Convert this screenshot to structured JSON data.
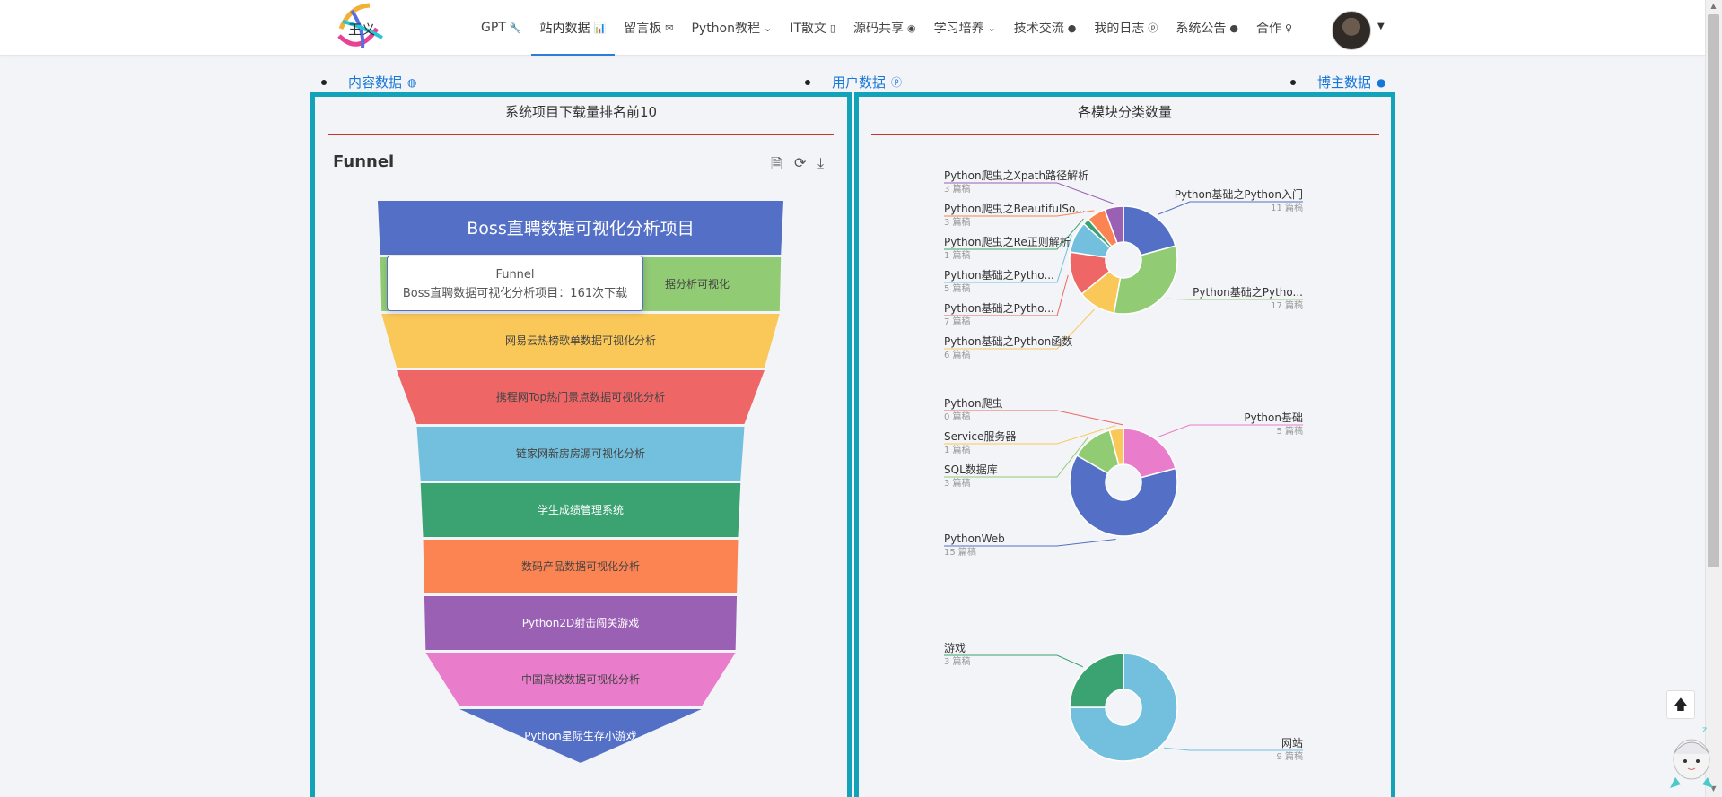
{
  "nav": {
    "items": [
      {
        "label": "GPT",
        "icon": "🔧"
      },
      {
        "label": "站内数据",
        "icon": "📊",
        "active": true
      },
      {
        "label": "留言板",
        "icon": "✉"
      },
      {
        "label": "Python教程",
        "icon": "⌄"
      },
      {
        "label": "IT散文",
        "icon": "▯"
      },
      {
        "label": "源码共享",
        "icon": "◉"
      },
      {
        "label": "学习培养",
        "icon": "⌄"
      },
      {
        "label": "技术交流",
        "icon": "●"
      },
      {
        "label": "我的日志",
        "icon": "ⓟ"
      },
      {
        "label": "系统公告",
        "icon": "●"
      },
      {
        "label": "合作",
        "icon": "♀"
      }
    ],
    "logo_icon": "logo-mark"
  },
  "tabs": [
    {
      "label": "内容数据",
      "icon": "◍"
    },
    {
      "label": "用户数据",
      "icon": "ⓟ"
    },
    {
      "label": "博主数据",
      "icon": "●"
    }
  ],
  "left_panel": {
    "title": "系统项目下载量排名前10",
    "chart_heading": "Funnel",
    "tooltip": {
      "title": "Funnel",
      "body": "Boss直聘数据可视化分析项目：161次下载"
    }
  },
  "right_panel": {
    "title": "各模块分类数量"
  },
  "chart_data": [
    {
      "type": "funnel",
      "title": "Funnel",
      "series_name": "Funnel",
      "categories": [
        "Boss直聘数据可视化分析项目",
        "",
        "网易云热榜歌单数据可视化分析",
        "携程网Top热门景点数据可视化分析",
        "链家网新房房源可视化分析",
        "学生成绩管理系统",
        "数码产品数据可视化分析",
        "Python2D射击闯关游戏",
        "中国高校数据可视化分析",
        "Python星际生存小游戏"
      ],
      "values": [
        161,
        159,
        158,
        146,
        130,
        127,
        125,
        124,
        123,
        96
      ],
      "colors": [
        "#5470c6",
        "#91cc75",
        "#fac858",
        "#ee6666",
        "#73c0de",
        "#3ba272",
        "#fc8452",
        "#9a60b4",
        "#ea7ccc",
        "#5470c6"
      ],
      "visible_label_2": "据分析可视化"
    },
    {
      "type": "pie",
      "donut": true,
      "slices": [
        {
          "name": "Python基础之Python入门",
          "value": 11,
          "label": "11 篇稿",
          "color": "#5470c6"
        },
        {
          "name": "Python基础之Pytho...",
          "value": 17,
          "label": "17 篇稿",
          "color": "#91cc75"
        },
        {
          "name": "Python基础之Python函数",
          "value": 6,
          "label": "6 篇稿",
          "color": "#fac858"
        },
        {
          "name": "Python基础之Pytho...",
          "value": 7,
          "label": "7 篇稿",
          "color": "#ee6666"
        },
        {
          "name": "Python基础之Pytho...",
          "value": 5,
          "label": "5 篇稿",
          "color": "#73c0de"
        },
        {
          "name": "Python爬虫之Re正则解析",
          "value": 1,
          "label": "1 篇稿",
          "color": "#3ba272"
        },
        {
          "name": "Python爬虫之BeautifulSo...",
          "value": 3,
          "label": "3 篇稿",
          "color": "#fc8452"
        },
        {
          "name": "Python爬虫之Xpath路径解析",
          "value": 3,
          "label": "3 篇稿",
          "color": "#9a60b4"
        }
      ]
    },
    {
      "type": "pie",
      "donut": true,
      "slices": [
        {
          "name": "Python基础",
          "value": 5,
          "label": "5 篇稿",
          "color": "#ea7ccc"
        },
        {
          "name": "PythonWeb",
          "value": 15,
          "label": "15 篇稿",
          "color": "#5470c6"
        },
        {
          "name": "SQL数据库",
          "value": 3,
          "label": "3 篇稿",
          "color": "#91cc75"
        },
        {
          "name": "Service服务器",
          "value": 1,
          "label": "1 篇稿",
          "color": "#fac858"
        },
        {
          "name": "Python爬虫",
          "value": 0,
          "label": "0 篇稿",
          "color": "#ee6666"
        }
      ]
    },
    {
      "type": "pie",
      "donut": true,
      "slices": [
        {
          "name": "网站",
          "value": 9,
          "label": "9 篇稿",
          "color": "#73c0de"
        },
        {
          "name": "游戏",
          "value": 3,
          "label": "3 篇稿",
          "color": "#3ba272"
        }
      ]
    }
  ],
  "ui": {
    "back_top_icon": "arrow-up-icon",
    "back_top_glyph": "🡅"
  }
}
